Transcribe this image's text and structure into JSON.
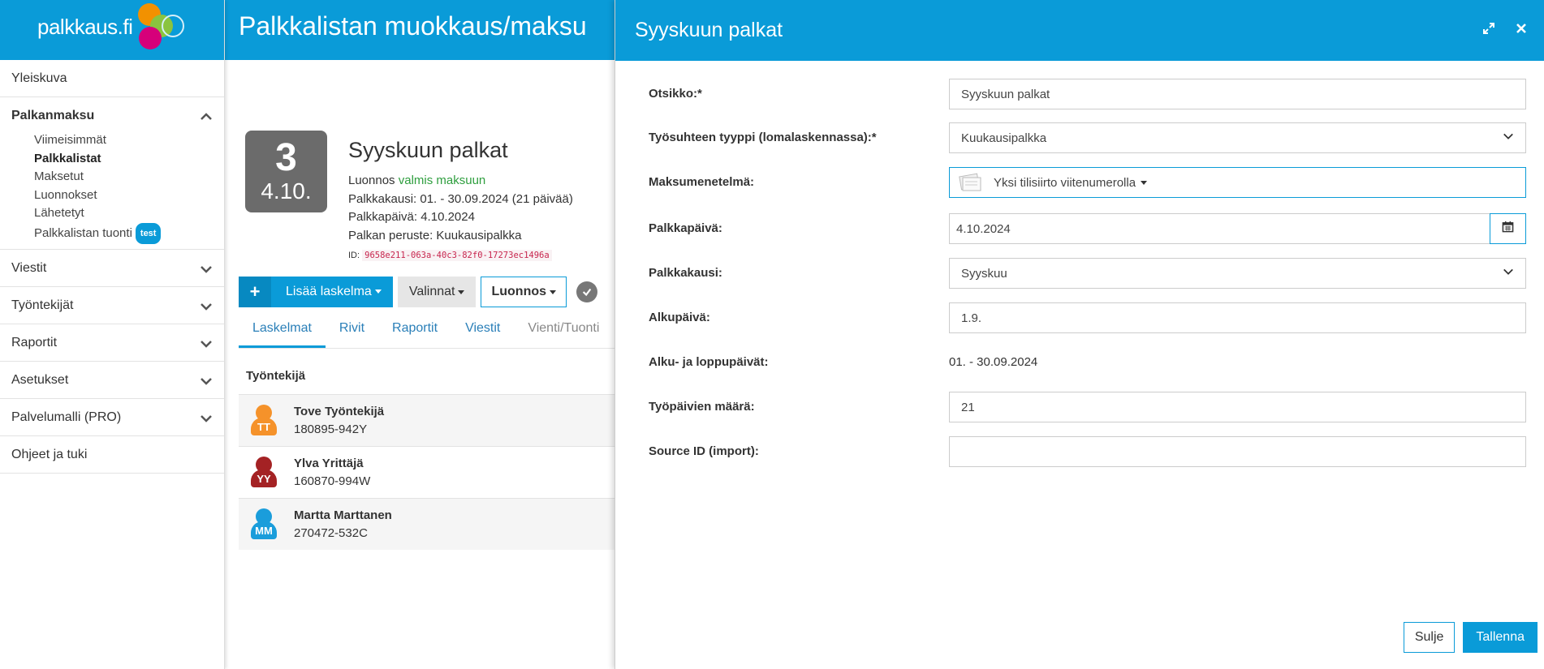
{
  "sidebar": {
    "logo": "palkkaus.fi",
    "brand_colors": [
      "#f29100",
      "#8ac43f",
      "#d6007a",
      "#0a9bd8"
    ],
    "items": [
      {
        "label": "Yleiskuva"
      },
      {
        "label": "Palkanmaksu"
      },
      {
        "label": "Viestit"
      },
      {
        "label": "Työntekijät"
      },
      {
        "label": "Raportit"
      },
      {
        "label": "Asetukset"
      },
      {
        "label": "Palvelumalli (PRO)"
      },
      {
        "label": "Ohjeet ja tuki"
      }
    ],
    "sub": {
      "latest": "Viimeisimmät",
      "lists": "Palkkalistat",
      "paid": "Maksetut",
      "drafts": "Luonnokset",
      "sent": "Lähetetyt",
      "import": "Palkkalistan tuonti",
      "import_badge": "test"
    }
  },
  "main": {
    "header_title": "Palkkalistan muokkaus/maksu",
    "tile_count": "3",
    "tile_date": "4.10.",
    "title": "Syyskuun palkat",
    "status_prefix": "Luonnos",
    "status_ready": "valmis maksuun",
    "period_line": "Palkkakausi: 01. - 30.09.2024 (21 päivää)",
    "paydate_line": "Palkkapäivä: 4.10.2024",
    "basis_line": "Palkan peruste: Kuukausipalkka",
    "id_label": "ID:",
    "id_value": "9658e211-063a-40c3-82f0-17273ec1496a",
    "toolbar": {
      "add_label": "Lisää laskelma",
      "options_label": "Valinnat",
      "draft_label": "Luonnos"
    },
    "tabs": [
      "Laskelmat",
      "Rivit",
      "Raportit",
      "Viestit",
      "Vienti/Tuonti"
    ],
    "employee_header": "Työntekijä",
    "employees": [
      {
        "name": "Tove Työntekijä",
        "ssn": "180895-942Y",
        "initials": "TT",
        "color": "#f5922a"
      },
      {
        "name": "Ylva Yrittäjä",
        "ssn": "160870-994W",
        "initials": "YY",
        "color": "#a42224"
      },
      {
        "name": "Martta Marttanen",
        "ssn": "270472-532C",
        "initials": "MM",
        "color": "#1a9ddb"
      }
    ]
  },
  "dialog": {
    "title": "Syyskuun palkat",
    "fields": {
      "title_label": "Otsikko:*",
      "title_value": "Syyskuun palkat",
      "emp_type_label": "Työsuhteen tyyppi (lomalaskennassa):*",
      "emp_type_value": "Kuukausipalkka",
      "pay_method_label": "Maksumenetelmä:",
      "pay_method_value": "Yksi tilisiirto viitenumerolla",
      "pay_date_label": "Palkkapäivä:",
      "pay_date_value": "4.10.2024",
      "period_label": "Palkkakausi:",
      "period_value": "Syyskuu",
      "start_label": "Alkupäivä:",
      "start_value": "1.9.",
      "range_label": "Alku- ja loppupäivät:",
      "range_value": "01. - 30.09.2024",
      "workdays_label": "Työpäivien määrä:",
      "workdays_value": "21",
      "source_label": "Source ID (import):",
      "source_value": ""
    },
    "close_label": "Sulje",
    "save_label": "Tallenna"
  }
}
